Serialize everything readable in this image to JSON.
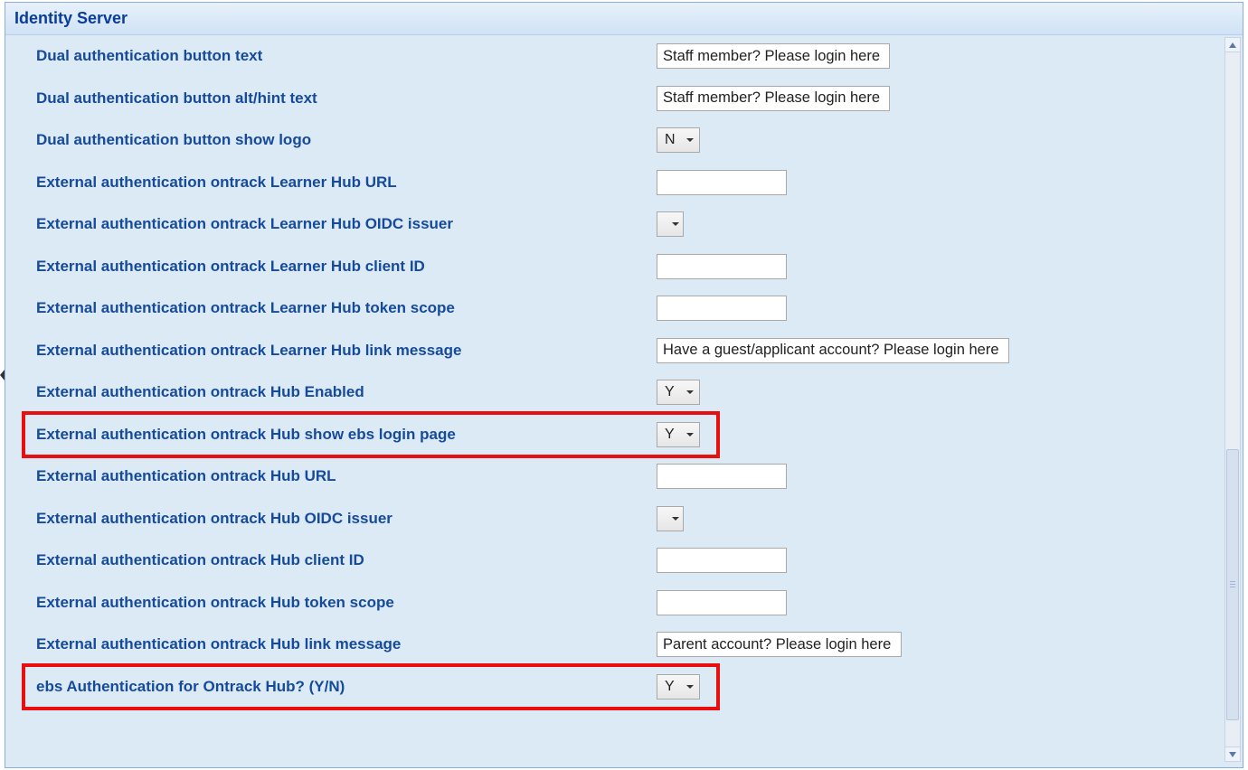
{
  "panel": {
    "title": "Identity Server"
  },
  "rows": [
    {
      "label": "Dual authentication button text",
      "type": "text",
      "value": "Staff member? Please login here",
      "wide": true
    },
    {
      "label": "Dual authentication button alt/hint text",
      "type": "text",
      "value": "Staff member? Please login here",
      "wide": true
    },
    {
      "label": "Dual authentication button show logo",
      "type": "dropdown",
      "value": "N"
    },
    {
      "label": "External authentication ontrack Learner Hub URL",
      "type": "text",
      "value": ""
    },
    {
      "label": "External authentication ontrack Learner Hub OIDC issuer",
      "type": "dropdown",
      "value": ""
    },
    {
      "label": "External authentication ontrack Learner Hub client ID",
      "type": "text",
      "value": ""
    },
    {
      "label": "External authentication ontrack Learner Hub token scope",
      "type": "text",
      "value": ""
    },
    {
      "label": "External authentication ontrack Learner Hub link message",
      "type": "text",
      "value": "Have a guest/applicant account? Please login here",
      "wide": true
    },
    {
      "label": "External authentication ontrack Hub Enabled",
      "type": "dropdown",
      "value": "Y"
    },
    {
      "label": "External authentication ontrack Hub show ebs login page",
      "type": "dropdown",
      "value": "Y",
      "highlight": true
    },
    {
      "label": "External authentication ontrack Hub URL",
      "type": "text",
      "value": ""
    },
    {
      "label": "External authentication ontrack Hub OIDC issuer",
      "type": "dropdown",
      "value": ""
    },
    {
      "label": "External authentication ontrack Hub client ID",
      "type": "text",
      "value": ""
    },
    {
      "label": "External authentication ontrack Hub token scope",
      "type": "text",
      "value": ""
    },
    {
      "label": "External authentication ontrack Hub link message",
      "type": "text",
      "value": "Parent account? Please login here",
      "wide": true
    },
    {
      "label": "ebs Authentication for Ontrack Hub? (Y/N)",
      "type": "dropdown",
      "value": "Y",
      "highlight": true
    }
  ]
}
